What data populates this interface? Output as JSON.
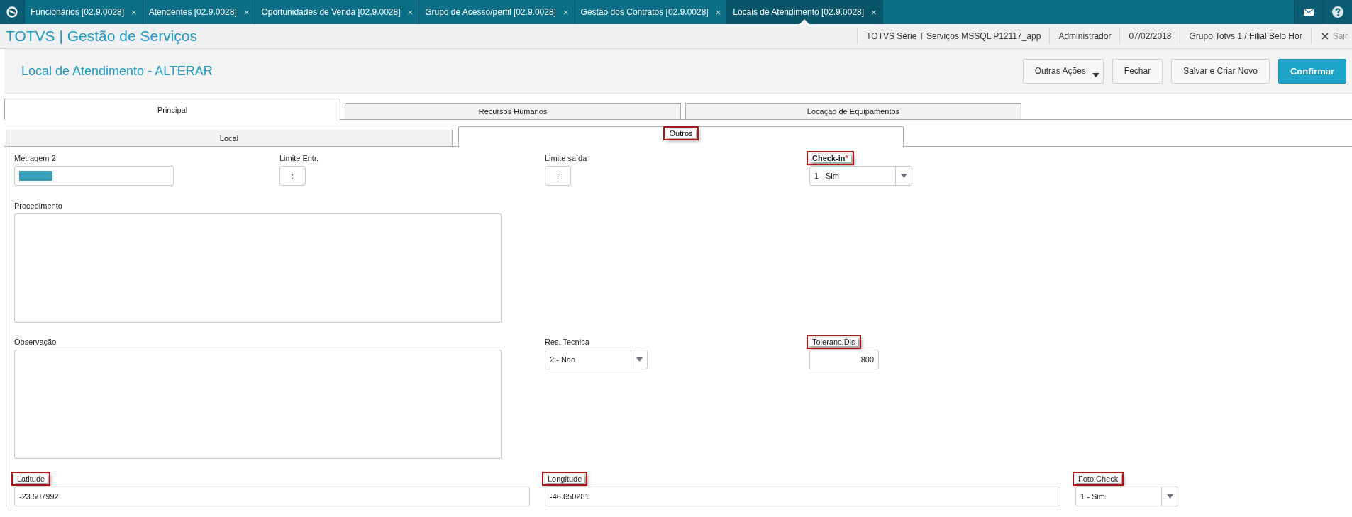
{
  "app_tabs": [
    {
      "label": "Funcionários [02.9.0028]",
      "close": "×",
      "selected": false
    },
    {
      "label": "Atendentes [02.9.0028]",
      "close": "×",
      "selected": false
    },
    {
      "label": "Oportunidades de Venda [02.9.0028]",
      "close": "×",
      "selected": false
    },
    {
      "label": "Grupo de Acesso/perfil [02.9.0028]",
      "close": "×",
      "selected": false
    },
    {
      "label": "Gestão dos Contratos [02.9.0028]",
      "close": "×",
      "selected": false
    },
    {
      "label": "Locais de Atendimento [02.9.0028]",
      "close": "×",
      "selected": true
    }
  ],
  "header": {
    "title": "TOTVS | Gestão de Serviços",
    "info": [
      "TOTVS Série T Serviços MSSQL P12117_app",
      "Administrador",
      "07/02/2018",
      "Grupo Totvs 1 / Filial Belo Hor"
    ],
    "logout": "Sair"
  },
  "page": {
    "title": "Local de Atendimento - ALTERAR"
  },
  "buttons": [
    {
      "label": "Outras Ações",
      "kind": "menu"
    },
    {
      "label": "Fechar",
      "kind": "default"
    },
    {
      "label": "Salvar e Criar Novo",
      "kind": "default"
    },
    {
      "label": "Confirmar",
      "kind": "primary"
    }
  ],
  "tabs": [
    {
      "label": "Principal",
      "selected": true
    },
    {
      "label": "Recursos Humanos",
      "selected": false
    },
    {
      "label": "Locação de Equipamentos",
      "selected": false
    }
  ],
  "subtabs": [
    {
      "label": "Local",
      "selected": false,
      "annotated": false
    },
    {
      "label": "Outros",
      "selected": true,
      "annotated": true
    }
  ],
  "fields": [
    {
      "label": "Metragem 2",
      "kind": "selection",
      "annotated": false
    },
    {
      "label": "Limite Entr.",
      "kind": "time",
      "value": ":",
      "annotated": false
    },
    {
      "label": "Limite saída",
      "kind": "time",
      "value": ":",
      "annotated": false
    },
    {
      "label": "Check-in",
      "required_mark": "*",
      "kind": "select",
      "value": "1 - Sim",
      "annotated": true
    },
    {
      "label": "Procedimento",
      "kind": "textarea",
      "annotated": false
    },
    {
      "label": "Observação",
      "kind": "textarea",
      "annotated": false
    },
    {
      "label": "Res. Tecnica",
      "kind": "select",
      "value": "2 - Nao",
      "annotated": false
    },
    {
      "label": "Toleranc.Dis",
      "kind": "number",
      "value": "800",
      "annotated": true
    },
    {
      "label": "Latitude",
      "kind": "text",
      "value": "-23.507992",
      "annotated": true
    },
    {
      "label": "Longitude",
      "kind": "text",
      "value": "-46.650281",
      "annotated": true
    },
    {
      "label": "Foto Check",
      "kind": "select",
      "value": "1 - Sim",
      "annotated": true
    }
  ]
}
